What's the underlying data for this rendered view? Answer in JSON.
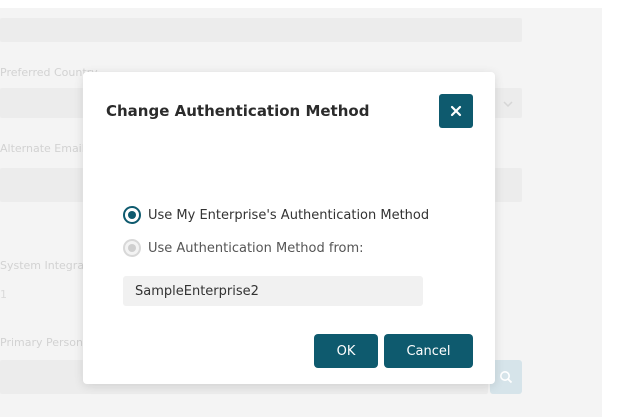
{
  "background_form": {
    "preferred_country_label": "Preferred Country",
    "alternate_email_label": "Alternate Email",
    "system_integration_label": "System Integration",
    "primary_person_label": "Primary Person",
    "placeholder_digit": "1"
  },
  "modal": {
    "title": "Change Authentication Method",
    "options": [
      {
        "label": "Use My Enterprise's Authentication Method",
        "selected": true
      },
      {
        "label": "Use Authentication Method from:",
        "selected": false
      }
    ],
    "enterprise_value": "SampleEnterprise2",
    "ok_label": "OK",
    "cancel_label": "Cancel"
  },
  "icons": {
    "close": "close-icon",
    "search": "search-icon",
    "dropdown": "chevron-down-icon"
  },
  "colors": {
    "accent": "#0e5a6e",
    "overlay_background": "#f4f4f4"
  }
}
